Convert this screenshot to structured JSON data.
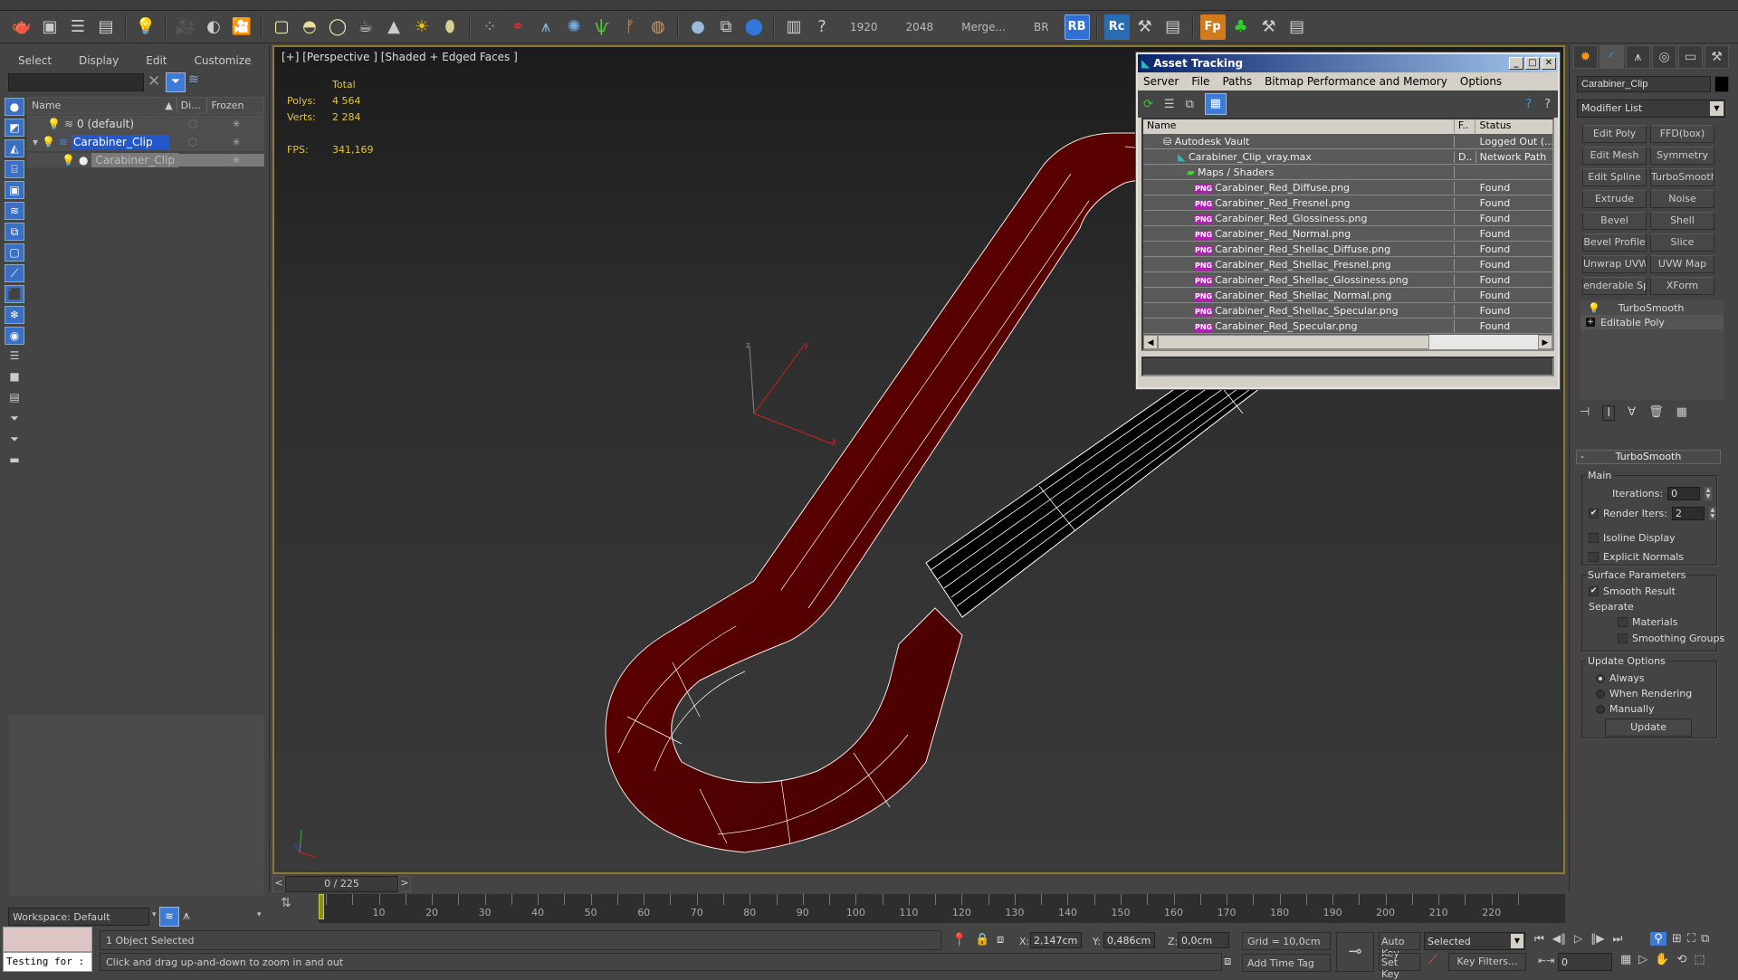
{
  "toolbar": {
    "icons": [
      "teapot-icon",
      "render-frame-icon",
      "render-setup-icon",
      "render-settings-icon",
      "light-list-icon",
      "camera-icon",
      "camera-target-icon",
      "video-camera-icon",
      "plane-icon",
      "dome-icon",
      "sphere-light-icon",
      "teapot-mesh-icon",
      "cone-light-icon",
      "sun-icon",
      "ies-icon",
      "particles-icon",
      "molecule-icon",
      "tower-icon",
      "fur-icon",
      "grass-icon",
      "hair-hf-icon",
      "hair-ox-icon",
      "sphere-icon",
      "material-browser-icon",
      "proxy-icon",
      "frame-buffer-icon",
      "help-icon"
    ],
    "texts": [
      "1920",
      "2048",
      "Merge...",
      "BR"
    ],
    "rb_label": "RB",
    "rc_label": "Rc",
    "fp_label": "Fp"
  },
  "scene_explorer": {
    "menu": [
      "Select",
      "Display",
      "Edit",
      "Customize"
    ],
    "search_value": "",
    "columns": {
      "name": "Name",
      "display": "Di...",
      "frozen": "Frozen"
    },
    "rows": [
      {
        "name": "0 (default)",
        "type": "layer",
        "selected": false,
        "indent": 1
      },
      {
        "name": "Carabiner_Clip",
        "type": "layer",
        "selected": true,
        "indent": 1
      },
      {
        "name": "Carabiner_Clip",
        "type": "object",
        "selected": false,
        "indent": 2
      }
    ],
    "workspace": "Workspace: Default"
  },
  "viewport": {
    "label": "[+] [Perspective ] [Shaded + Edged Faces ]",
    "stats": {
      "header": "Total",
      "polys_label": "Polys:",
      "polys": "4 564",
      "verts_label": "Verts:",
      "verts": "2 284",
      "fps_label": "FPS:",
      "fps": "341,169"
    },
    "gizmo": {
      "x": "x",
      "y": "y",
      "z": "z"
    }
  },
  "asset_tracking": {
    "title": "Asset Tracking",
    "menu": [
      "Server",
      "File",
      "Paths",
      "Bitmap Performance and Memory",
      "Options"
    ],
    "columns": {
      "name": "Name",
      "f": "F..",
      "status": "Status"
    },
    "rows": [
      {
        "name": "Autodesk Vault",
        "f": "",
        "status": "Logged Out (..."
      },
      {
        "name": "Carabiner_Clip_vray.max",
        "f": "D..",
        "status": "Network Path"
      },
      {
        "name": "Maps / Shaders",
        "f": "",
        "status": ""
      },
      {
        "name": "Carabiner_Red_Diffuse.png",
        "f": "",
        "status": "Found"
      },
      {
        "name": "Carabiner_Red_Fresnel.png",
        "f": "",
        "status": "Found"
      },
      {
        "name": "Carabiner_Red_Glossiness.png",
        "f": "",
        "status": "Found"
      },
      {
        "name": "Carabiner_Red_Normal.png",
        "f": "",
        "status": "Found"
      },
      {
        "name": "Carabiner_Red_Shellac_Diffuse.png",
        "f": "",
        "status": "Found"
      },
      {
        "name": "Carabiner_Red_Shellac_Fresnel.png",
        "f": "",
        "status": "Found"
      },
      {
        "name": "Carabiner_Red_Shellac_Glossiness.png",
        "f": "",
        "status": "Found"
      },
      {
        "name": "Carabiner_Red_Shellac_Normal.png",
        "f": "",
        "status": "Found"
      },
      {
        "name": "Carabiner_Red_Shellac_Specular.png",
        "f": "",
        "status": "Found"
      },
      {
        "name": "Carabiner_Red_Specular.png",
        "f": "",
        "status": "Found"
      }
    ],
    "png_badge": "PNG"
  },
  "command_panel": {
    "object_name": "Carabiner_Clip",
    "modifier_list": "Modifier List",
    "modifier_buttons": [
      "Edit Poly",
      "FFD(box)",
      "Edit Mesh",
      "Symmetry",
      "Edit Spline",
      "TurboSmooth",
      "Extrude",
      "Noise",
      "Bevel",
      "Shell",
      "Bevel Profile",
      "Slice",
      "Unwrap UVW",
      "UVW Map",
      "enderable Splin",
      "XForm"
    ],
    "stack": [
      "TurboSmooth",
      "Editable Poly"
    ],
    "turbosmooth": {
      "title": "TurboSmooth",
      "collapse": "-",
      "main_label": "Main",
      "iterations_label": "Iterations:",
      "iterations": "0",
      "render_iters_label": "Render Iters:",
      "render_iters": "2",
      "render_iters_checked": true,
      "isoline_label": "Isoline Display",
      "isoline_checked": false,
      "explicit_label": "Explicit Normals",
      "explicit_checked": false,
      "surface_label": "Surface Parameters",
      "smooth_result_label": "Smooth Result",
      "smooth_result_checked": true,
      "separate_label": "Separate",
      "materials_label": "Materials",
      "materials_checked": false,
      "smoothing_groups_label": "Smoothing Groups",
      "smoothing_groups_checked": false,
      "update_label": "Update Options",
      "update_options": [
        "Always",
        "When Rendering",
        "Manually"
      ],
      "update_selected": "Always",
      "update_button": "Update"
    }
  },
  "timeline": {
    "slider": "0 / 225",
    "current_frame": 0,
    "total_frames": 225,
    "ticks": [
      "10",
      "20",
      "30",
      "40",
      "50",
      "60",
      "70",
      "80",
      "90",
      "100",
      "110",
      "120",
      "130",
      "140",
      "150",
      "160",
      "170",
      "180",
      "190",
      "200",
      "210",
      "220"
    ]
  },
  "status": {
    "maxscript_value": "Testing for :",
    "selected": "1 Object Selected",
    "prompt": "Click and drag up-and-down to zoom in and out",
    "x_label": "X:",
    "x": "2,147cm",
    "y_label": "Y:",
    "y": "0,486cm",
    "z_label": "Z:",
    "z": "0,0cm",
    "grid": "Grid = 10,0cm",
    "add_time_tag": "Add Time Tag",
    "auto_key": "Auto Key",
    "set_key": "Set Key",
    "selected_dd": "Selected",
    "key_filters": "Key Filters...",
    "frame": "0"
  }
}
